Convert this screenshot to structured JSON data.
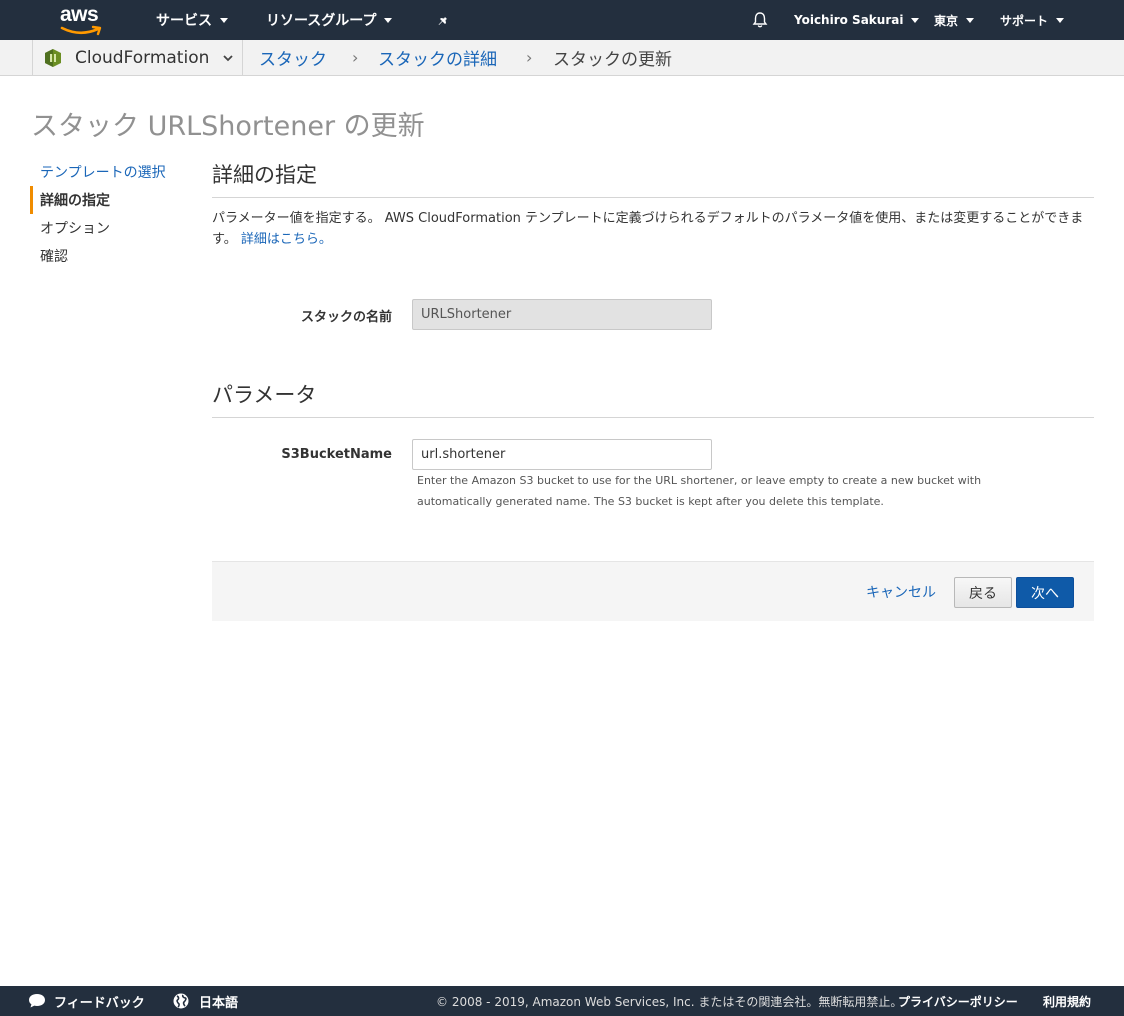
{
  "topnav": {
    "logo_text": "aws",
    "services": "サービス",
    "resource_groups": "リソースグループ",
    "user": "Yoichiro Sakurai",
    "region": "東京",
    "support": "サポート"
  },
  "breadcrumb": {
    "service": "CloudFormation",
    "items": [
      "スタック",
      "スタックの詳細",
      "スタックの更新"
    ],
    "separator": "›"
  },
  "page": {
    "title": "スタック URLShortener の更新"
  },
  "wizard_steps": [
    {
      "label": "テンプレートの選択"
    },
    {
      "label": "詳細の指定"
    },
    {
      "label": "オプション"
    },
    {
      "label": "確認"
    }
  ],
  "details": {
    "heading": "詳細の指定",
    "description": "パラメーター値を指定する。 AWS CloudFormation テンプレートに定義づけられるデフォルトのパラメータ値を使用、または変更することができます。",
    "more_link": "詳細はこちら。",
    "stack_name_label": "スタックの名前",
    "stack_name_value": "URLShortener"
  },
  "parameters": {
    "heading": "パラメータ",
    "s3_label": "S3BucketName",
    "s3_value": "url.shortener",
    "s3_help": "Enter the Amazon S3 bucket to use for the URL shortener, or leave empty to create a new bucket with automatically generated name. The S3 bucket is kept after you delete this template."
  },
  "actions": {
    "cancel": "キャンセル",
    "back": "戻る",
    "next": "次へ"
  },
  "footer": {
    "feedback": "フィードバック",
    "language": "日本語",
    "copyright": "© 2008 - 2019, Amazon Web Services, Inc. またはその関連会社。無断転用禁止。",
    "privacy": "プライバシーポリシー",
    "terms": "利用規約"
  },
  "colors": {
    "nav_bg": "#232f3e",
    "link": "#1a66b8",
    "primary_button": "#0f5aa8",
    "active_step_marker": "#f08c00"
  }
}
